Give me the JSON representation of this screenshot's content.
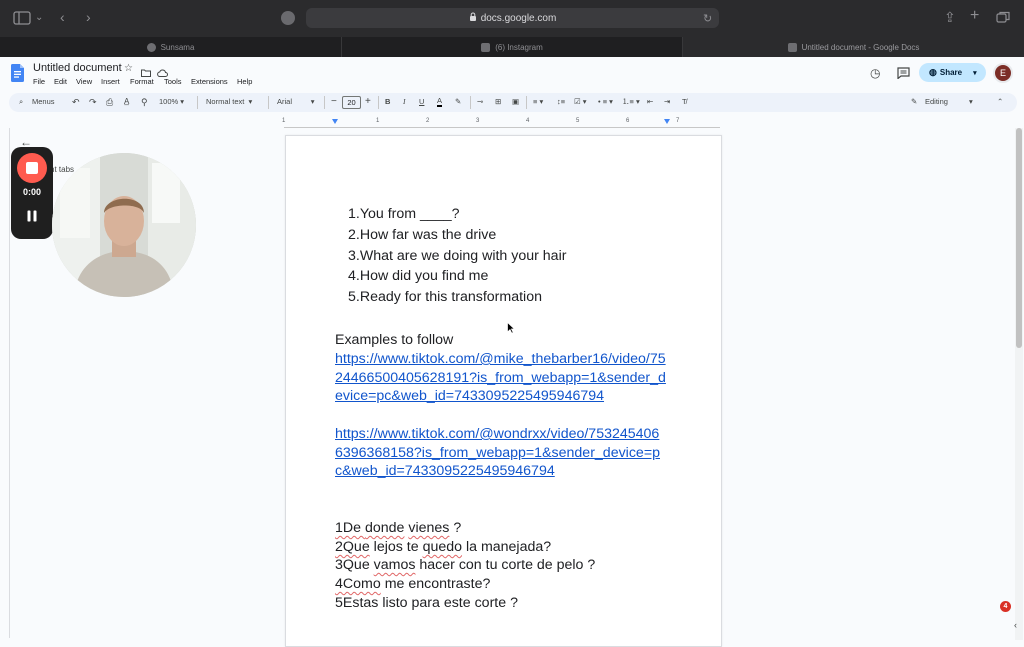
{
  "browser": {
    "url": "docs.google.com",
    "tabs": [
      {
        "label": "Sunsama"
      },
      {
        "label": "(6) Instagram"
      },
      {
        "label": "Untitled document - Google Docs"
      }
    ]
  },
  "docs": {
    "title": "Untitled document",
    "menu": [
      "File",
      "Edit",
      "View",
      "Insert",
      "Format",
      "Tools",
      "Extensions",
      "Help"
    ],
    "share_label": "Share",
    "avatar_letter": "E",
    "toolbar": {
      "menus_label": "Menus",
      "zoom": "100%",
      "style": "Normal text",
      "font": "Arial",
      "font_size": "20",
      "mode": "Editing"
    },
    "ruler_ticks": [
      "1",
      "1",
      "2",
      "3",
      "4",
      "5",
      "6",
      "7"
    ],
    "sidebar_label": "nt tabs"
  },
  "recorder": {
    "time": "0:00"
  },
  "document": {
    "numbered_list": [
      {
        "num": "1.",
        "text": "You from ____?"
      },
      {
        "num": "2.",
        "text": "How far was the drive"
      },
      {
        "num": "3.",
        "text": "What are we doing with your hair"
      },
      {
        "num": "4.",
        "text": "How did you find me"
      },
      {
        "num": "5.",
        "text": "Ready for this transformation"
      }
    ],
    "examples_heading": "Examples to follow",
    "link1_lines": [
      "https://www.tiktok.com/@mike_thebarber16/video/75",
      "24466500405628191?is_from_webapp=1&sender_d",
      "evice=pc&web_id=7433095225495946794"
    ],
    "link2_lines": [
      "https://www.tiktok.com/@wondrxx/video/753245406",
      "6396368158?is_from_webapp=1&sender_device=p",
      "c&web_id=7433095225495946794"
    ],
    "spanish": {
      "l1_a": "1De ",
      "l1_b": "donde",
      "l1_c": " ",
      "l1_d": "vienes",
      "l1_e": " ?",
      "l2_a": "2Que",
      "l2_b": " lejos te ",
      "l2_c": "quedo",
      "l2_d": " la manejada?",
      "l3_a": "3Que ",
      "l3_b": "vamos",
      "l3_c": " hacer con tu corte de pelo ?",
      "l4_a": "4Como",
      "l4_b": " me encontraste?",
      "l5": "5Estas listo para este corte ?"
    }
  },
  "notification_count": "4",
  "colors": {
    "link": "#1155cc",
    "share_bg": "#c2e7ff",
    "record_red": "#ff5b4f"
  }
}
